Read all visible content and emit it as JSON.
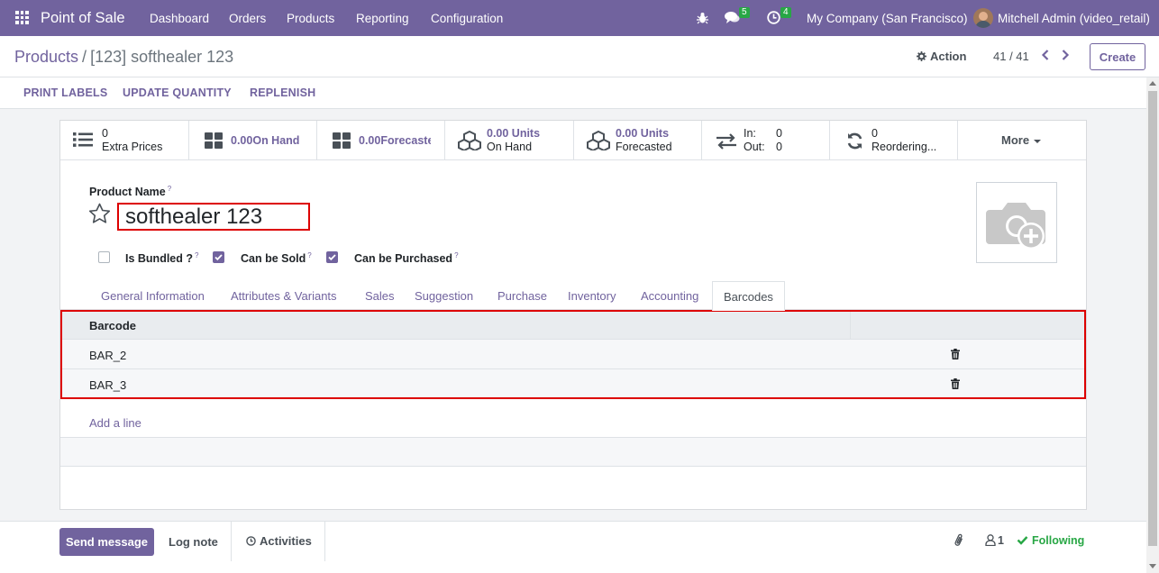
{
  "navbar": {
    "app_name": "Point of Sale",
    "menu": [
      "Dashboard",
      "Orders",
      "Products",
      "Reporting",
      "Configuration"
    ],
    "messages_count": "5",
    "activities_count": "4",
    "company": "My Company (San Francisco)",
    "user": "Mitchell Admin (video_retail)"
  },
  "control_panel": {
    "breadcrumb_parent": "Products",
    "breadcrumb_separator": "/",
    "breadcrumb_current": "[123] softhealer 123",
    "action_label": "Action",
    "pager": "41 / 41",
    "create_label": "Create"
  },
  "statusbar": {
    "buttons": [
      "PRINT LABELS",
      "UPDATE QUANTITY",
      "REPLENISH"
    ]
  },
  "smart_buttons": {
    "extra_prices": {
      "value": "0",
      "label": "Extra Prices"
    },
    "on_hand": {
      "value": "0.00",
      "label": "On Hand"
    },
    "forecasted": {
      "value": "0.00",
      "label": "Forecasted"
    },
    "units_on_hand": {
      "value": "0.00 Units",
      "label": "On Hand"
    },
    "units_forecasted": {
      "value": "0.00 Units",
      "label": "Forecasted"
    },
    "in_out": {
      "in_label": "In:",
      "in_value": "0",
      "out_label": "Out:",
      "out_value": "0"
    },
    "reordering": {
      "value": "0",
      "label": "Reordering..."
    },
    "more_label": "More"
  },
  "form": {
    "product_name_label": "Product Name",
    "help_mark": "?",
    "product_name": "softhealer 123",
    "checkboxes": [
      {
        "label": "Is Bundled ?",
        "checked": false
      },
      {
        "label": "Can be Sold",
        "checked": true
      },
      {
        "label": "Can be Purchased",
        "checked": true
      }
    ]
  },
  "tabs": [
    "General Information",
    "Attributes & Variants",
    "Sales",
    "Suggestion",
    "Purchase",
    "Inventory",
    "Accounting",
    "Barcodes"
  ],
  "active_tab": "Barcodes",
  "barcodes": {
    "column_header": "Barcode",
    "rows": [
      "BAR_2",
      "BAR_3"
    ],
    "add_line": "Add a line"
  },
  "chatter": {
    "send_message": "Send message",
    "log_note": "Log note",
    "activities": "Activities",
    "followers_count": "1",
    "following": "Following"
  },
  "colors": {
    "brand": "#71639e",
    "highlight": "#dd0000",
    "success": "#28a745"
  }
}
